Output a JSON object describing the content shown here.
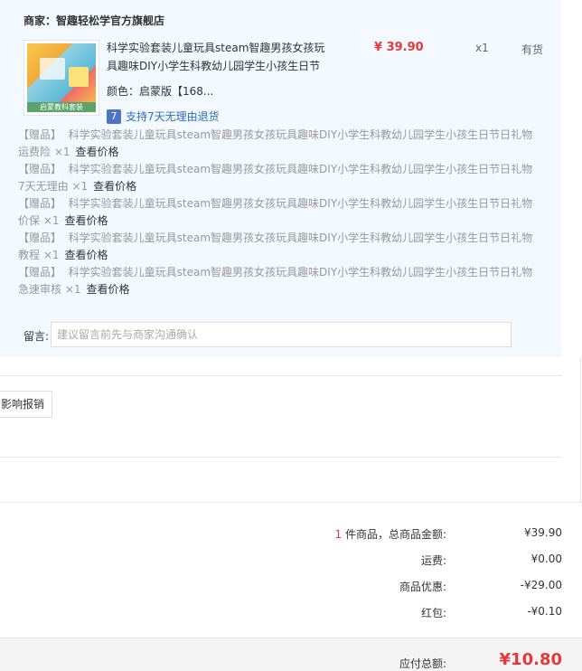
{
  "shop": {
    "label": "商家：智趣轻松学官方旗舰店"
  },
  "product": {
    "title": "科学实验套装儿童玩具steam智趣男孩女孩玩具趣味DIY小学生科教幼儿园学生小孩生日节",
    "price": "¥ 39.90",
    "qty": "x1",
    "stock": "有货",
    "color_label": "颜色：",
    "color_value": "启蒙版【168...",
    "thumb_caption": "启蒙教科套装",
    "return_icon": "7",
    "return_text": "支持7天无理由退货"
  },
  "gifts": [
    {
      "tag": "【赠品】",
      "name": "科学实验套装儿童玩具steam智趣男孩女孩玩具趣味DIY小学生科教幼儿园学生小孩生日节日礼物运费险",
      "mult": "×1",
      "link": "查看价格"
    },
    {
      "tag": "【赠品】",
      "name": "科学实验套装儿童玩具steam智趣男孩女孩玩具趣味DIY小学生科教幼儿园学生小孩生日节日礼物 7天无理由",
      "mult": "×1",
      "link": "查看价格"
    },
    {
      "tag": "【赠品】",
      "name": "科学实验套装儿童玩具steam智趣男孩女孩玩具趣味DIY小学生科教幼儿园学生小孩生日节日礼物价保",
      "mult": "×1",
      "link": "查看价格"
    },
    {
      "tag": "【赠品】",
      "name": "科学实验套装儿童玩具steam智趣男孩女孩玩具趣味DIY小学生科教幼儿园学生小孩生日节日礼物教程",
      "mult": "×1",
      "link": "查看价格"
    },
    {
      "tag": "【赠品】",
      "name": "科学实验套装儿童玩具steam智趣男孩女孩玩具趣味DIY小学生科教幼儿园学生小孩生日节日礼物急速审核",
      "mult": "×1",
      "link": "查看价格"
    }
  ],
  "remark": {
    "label": "留言:",
    "placeholder": "建议留言前先与商家沟通确认"
  },
  "invoice": {
    "button_label": "影响报销"
  },
  "summary": {
    "count": "1",
    "items_label": "件商品，总商品金额:",
    "items_value": "¥39.90",
    "shipping_label": "运费:",
    "shipping_value": "¥0.00",
    "discount_label": "商品优惠:",
    "discount_value": "-¥29.00",
    "redpacket_label": "红包:",
    "redpacket_value": "-¥0.10",
    "total_label": "应付总额:",
    "total_value": "¥10.80"
  },
  "colors": {
    "price_red": "#e4393c",
    "link_blue": "#2a6cc4",
    "panel_bg": "#f3f9ff"
  }
}
